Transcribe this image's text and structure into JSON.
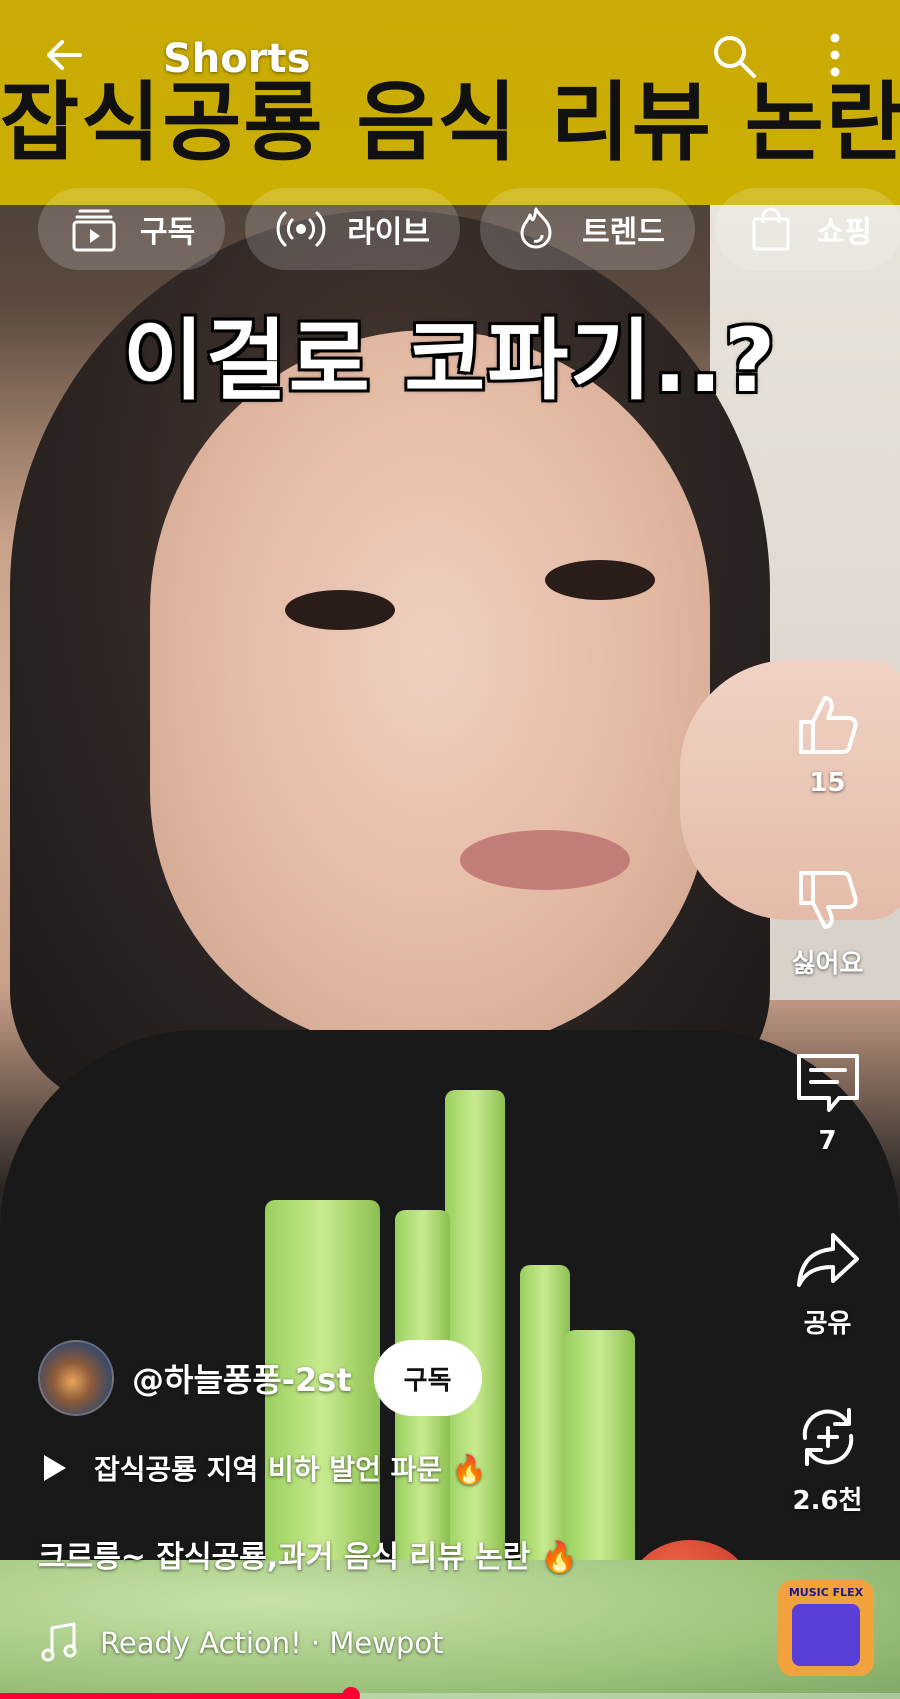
{
  "banner": {
    "title": "잡식공룡 음식 리뷰 논란"
  },
  "app_bar": {
    "title": "Shorts",
    "back_icon": "arrow-left-icon",
    "search_icon": "search-icon",
    "more_icon": "more-vertical-icon"
  },
  "chips": [
    {
      "label": "구독",
      "icon": "subscriptions-icon"
    },
    {
      "label": "라이브",
      "icon": "live-icon"
    },
    {
      "label": "트렌드",
      "icon": "trending-icon"
    },
    {
      "label": "쇼핑",
      "icon": "shopping-bag-icon"
    }
  ],
  "video": {
    "caption": "이걸로 코파기..?"
  },
  "actions": {
    "like_count": "15",
    "dislike_label": "싫어요",
    "comment_count": "7",
    "share_label": "공유",
    "remix_count": "2.6천"
  },
  "channel": {
    "handle": "@하늘퐁퐁-2st",
    "subscribe_label": "구독"
  },
  "related": {
    "text": "잡식공룡 지역 비하 발언 파문 🔥"
  },
  "description": "크르릉~ 잡식공룡,과거 음식 리뷰 논란 🔥",
  "music": {
    "track": "Ready Action! · Mewpot",
    "thumb_text": "MUSIC FLEX"
  },
  "progress": {
    "played_fraction": 0.39
  },
  "colors": {
    "banner": "#cbb000",
    "progress": "#ff0033",
    "subscribe_bg": "#ffffff"
  }
}
